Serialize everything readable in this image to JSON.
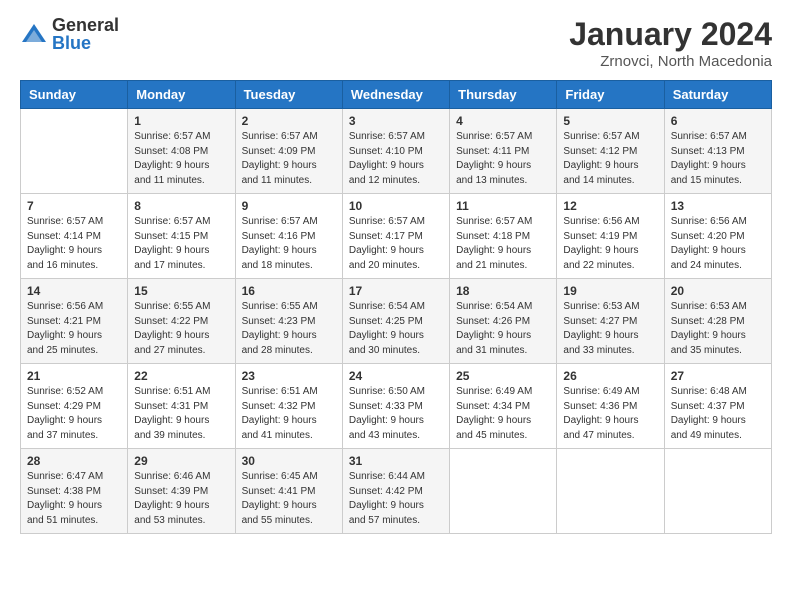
{
  "logo": {
    "general": "General",
    "blue": "Blue"
  },
  "title": "January 2024",
  "subtitle": "Zrnovci, North Macedonia",
  "days_of_week": [
    "Sunday",
    "Monday",
    "Tuesday",
    "Wednesday",
    "Thursday",
    "Friday",
    "Saturday"
  ],
  "weeks": [
    [
      {
        "num": "",
        "info": ""
      },
      {
        "num": "1",
        "info": "Sunrise: 6:57 AM\nSunset: 4:08 PM\nDaylight: 9 hours\nand 11 minutes."
      },
      {
        "num": "2",
        "info": "Sunrise: 6:57 AM\nSunset: 4:09 PM\nDaylight: 9 hours\nand 11 minutes."
      },
      {
        "num": "3",
        "info": "Sunrise: 6:57 AM\nSunset: 4:10 PM\nDaylight: 9 hours\nand 12 minutes."
      },
      {
        "num": "4",
        "info": "Sunrise: 6:57 AM\nSunset: 4:11 PM\nDaylight: 9 hours\nand 13 minutes."
      },
      {
        "num": "5",
        "info": "Sunrise: 6:57 AM\nSunset: 4:12 PM\nDaylight: 9 hours\nand 14 minutes."
      },
      {
        "num": "6",
        "info": "Sunrise: 6:57 AM\nSunset: 4:13 PM\nDaylight: 9 hours\nand 15 minutes."
      }
    ],
    [
      {
        "num": "7",
        "info": "Sunrise: 6:57 AM\nSunset: 4:14 PM\nDaylight: 9 hours\nand 16 minutes."
      },
      {
        "num": "8",
        "info": "Sunrise: 6:57 AM\nSunset: 4:15 PM\nDaylight: 9 hours\nand 17 minutes."
      },
      {
        "num": "9",
        "info": "Sunrise: 6:57 AM\nSunset: 4:16 PM\nDaylight: 9 hours\nand 18 minutes."
      },
      {
        "num": "10",
        "info": "Sunrise: 6:57 AM\nSunset: 4:17 PM\nDaylight: 9 hours\nand 20 minutes."
      },
      {
        "num": "11",
        "info": "Sunrise: 6:57 AM\nSunset: 4:18 PM\nDaylight: 9 hours\nand 21 minutes."
      },
      {
        "num": "12",
        "info": "Sunrise: 6:56 AM\nSunset: 4:19 PM\nDaylight: 9 hours\nand 22 minutes."
      },
      {
        "num": "13",
        "info": "Sunrise: 6:56 AM\nSunset: 4:20 PM\nDaylight: 9 hours\nand 24 minutes."
      }
    ],
    [
      {
        "num": "14",
        "info": "Sunrise: 6:56 AM\nSunset: 4:21 PM\nDaylight: 9 hours\nand 25 minutes."
      },
      {
        "num": "15",
        "info": "Sunrise: 6:55 AM\nSunset: 4:22 PM\nDaylight: 9 hours\nand 27 minutes."
      },
      {
        "num": "16",
        "info": "Sunrise: 6:55 AM\nSunset: 4:23 PM\nDaylight: 9 hours\nand 28 minutes."
      },
      {
        "num": "17",
        "info": "Sunrise: 6:54 AM\nSunset: 4:25 PM\nDaylight: 9 hours\nand 30 minutes."
      },
      {
        "num": "18",
        "info": "Sunrise: 6:54 AM\nSunset: 4:26 PM\nDaylight: 9 hours\nand 31 minutes."
      },
      {
        "num": "19",
        "info": "Sunrise: 6:53 AM\nSunset: 4:27 PM\nDaylight: 9 hours\nand 33 minutes."
      },
      {
        "num": "20",
        "info": "Sunrise: 6:53 AM\nSunset: 4:28 PM\nDaylight: 9 hours\nand 35 minutes."
      }
    ],
    [
      {
        "num": "21",
        "info": "Sunrise: 6:52 AM\nSunset: 4:29 PM\nDaylight: 9 hours\nand 37 minutes."
      },
      {
        "num": "22",
        "info": "Sunrise: 6:51 AM\nSunset: 4:31 PM\nDaylight: 9 hours\nand 39 minutes."
      },
      {
        "num": "23",
        "info": "Sunrise: 6:51 AM\nSunset: 4:32 PM\nDaylight: 9 hours\nand 41 minutes."
      },
      {
        "num": "24",
        "info": "Sunrise: 6:50 AM\nSunset: 4:33 PM\nDaylight: 9 hours\nand 43 minutes."
      },
      {
        "num": "25",
        "info": "Sunrise: 6:49 AM\nSunset: 4:34 PM\nDaylight: 9 hours\nand 45 minutes."
      },
      {
        "num": "26",
        "info": "Sunrise: 6:49 AM\nSunset: 4:36 PM\nDaylight: 9 hours\nand 47 minutes."
      },
      {
        "num": "27",
        "info": "Sunrise: 6:48 AM\nSunset: 4:37 PM\nDaylight: 9 hours\nand 49 minutes."
      }
    ],
    [
      {
        "num": "28",
        "info": "Sunrise: 6:47 AM\nSunset: 4:38 PM\nDaylight: 9 hours\nand 51 minutes."
      },
      {
        "num": "29",
        "info": "Sunrise: 6:46 AM\nSunset: 4:39 PM\nDaylight: 9 hours\nand 53 minutes."
      },
      {
        "num": "30",
        "info": "Sunrise: 6:45 AM\nSunset: 4:41 PM\nDaylight: 9 hours\nand 55 minutes."
      },
      {
        "num": "31",
        "info": "Sunrise: 6:44 AM\nSunset: 4:42 PM\nDaylight: 9 hours\nand 57 minutes."
      },
      {
        "num": "",
        "info": ""
      },
      {
        "num": "",
        "info": ""
      },
      {
        "num": "",
        "info": ""
      }
    ]
  ]
}
